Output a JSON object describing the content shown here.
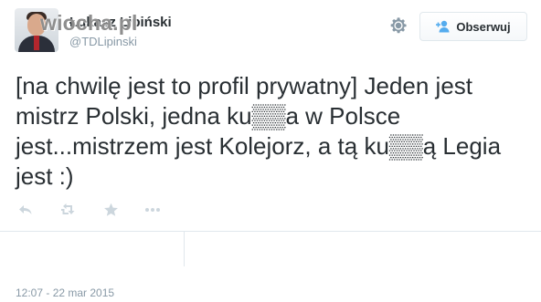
{
  "profile": {
    "display_name": "Łukasz Lipiński",
    "username": "@TDLipinski",
    "avatar_icon": "profile-photo"
  },
  "watermark": {
    "text": "wiocha.pl"
  },
  "header": {
    "settings_icon": "gear-icon",
    "follow_label": "Obserwuj",
    "follow_icon": "add-user-icon"
  },
  "tweet": {
    "text": "[na chwilę jest to profil prywatny] Jeden jest mistrz Polski, jedna ku▒▒a w Polsce jest...mistrzem jest Kolejorz, a tą ku▒▒ą Legia jest :)",
    "timestamp": "12:07 - 22 mar 2015"
  },
  "actions": [
    {
      "name": "reply",
      "icon": "reply-icon"
    },
    {
      "name": "retweet",
      "icon": "retweet-icon"
    },
    {
      "name": "favorite",
      "icon": "star-icon"
    },
    {
      "name": "more",
      "icon": "more-icon"
    }
  ],
  "colors": {
    "text": "#292f33",
    "muted": "#8899a6",
    "action_icon": "#ccd6dd",
    "accent": "#55acee",
    "border": "#e1e8ed"
  }
}
